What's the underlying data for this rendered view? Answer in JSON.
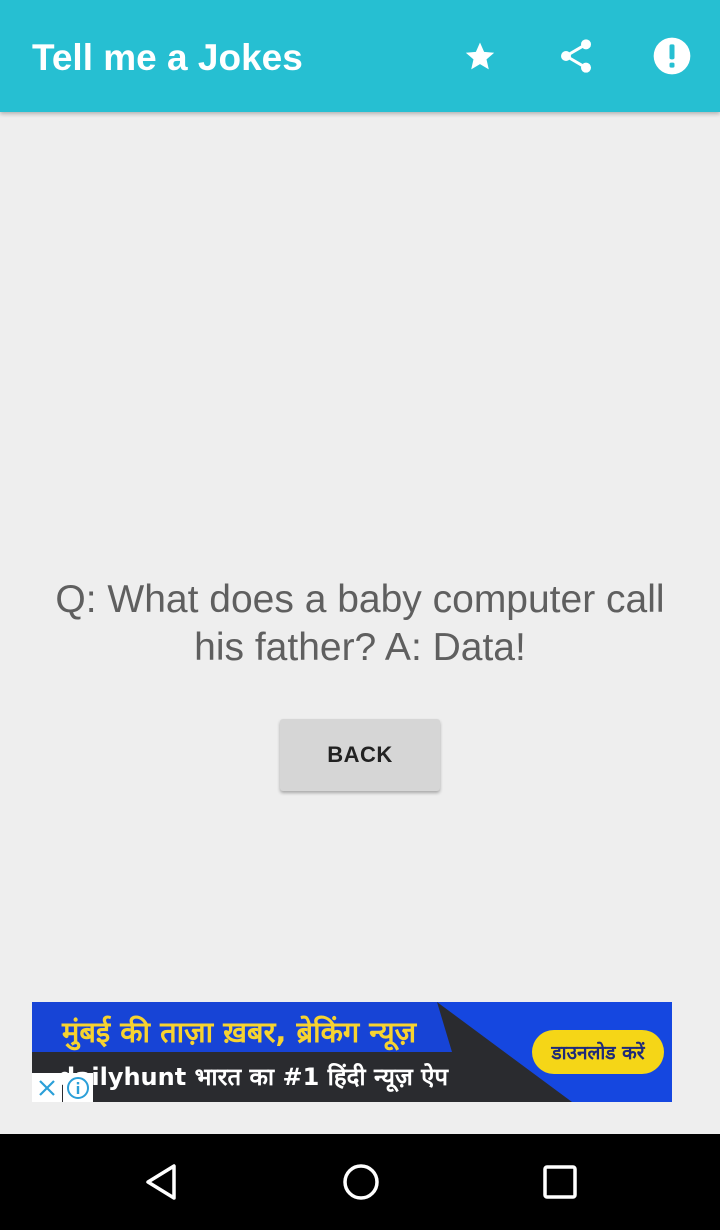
{
  "app_bar": {
    "title": "Tell me a Jokes",
    "background": "#26bfd2",
    "actions": [
      {
        "name": "favorite",
        "icon": "star-icon"
      },
      {
        "name": "share",
        "icon": "share-icon"
      },
      {
        "name": "about",
        "icon": "info-icon"
      }
    ]
  },
  "joke": {
    "text": "Q: What does a baby computer call his father? A: Data!"
  },
  "back_button": {
    "label": "BACK"
  },
  "ad": {
    "headline": "मुंबई की ताज़ा ख़बर, ब्रेकिंग न्यूज़",
    "brand": "dailyhunt",
    "tagline": "भारत का #1 हिंदी न्यूज़ ऐप",
    "cta": "डाउनलोड करें",
    "close_icon": "close-icon",
    "info_icon": "adchoices-info-icon"
  },
  "nav_bar": {
    "buttons": [
      {
        "name": "back",
        "icon": "triangle-back-icon"
      },
      {
        "name": "home",
        "icon": "circle-home-icon"
      },
      {
        "name": "recents",
        "icon": "square-recents-icon"
      }
    ]
  }
}
